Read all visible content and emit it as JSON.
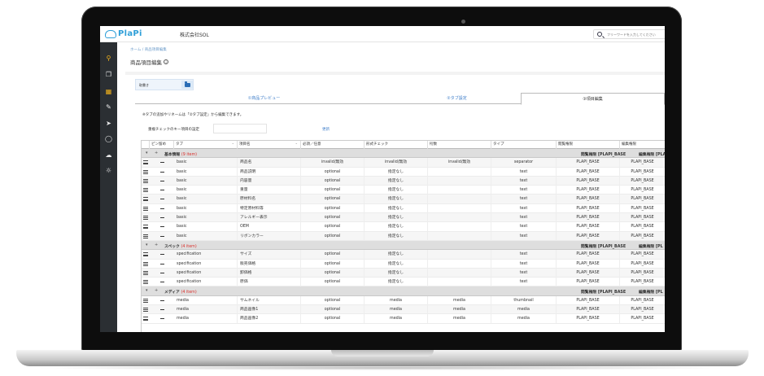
{
  "app": {
    "logo_text": "PlaPi",
    "company": "株式会社SOL",
    "search_placeholder": "フリーワードを入力してください"
  },
  "sidebar": {
    "items": [
      {
        "icon": "search-icon"
      },
      {
        "icon": "products-icon"
      },
      {
        "icon": "item-edit-icon"
      },
      {
        "icon": "pencil-icon"
      },
      {
        "icon": "rocket-icon"
      },
      {
        "icon": "shield-icon"
      },
      {
        "icon": "cloud-icon"
      },
      {
        "icon": "bulb-icon"
      }
    ],
    "more": "»"
  },
  "breadcrumb": "ホーム / 商品項目編集",
  "page_title": "商品項目編集",
  "info_glyph": "i",
  "file_input": {
    "label": "取書き"
  },
  "tabs": [
    {
      "label": "①商品プレビュー",
      "active": false
    },
    {
      "label": "②タブ設定",
      "active": false
    },
    {
      "label": "③項目編集",
      "active": true
    }
  ],
  "note": "※タブの追加やリネームは「②タブ設定」から編集できます。",
  "duplicate_check": {
    "label": "重複チェックのキー項目の設定",
    "link": "更新"
  },
  "table": {
    "headers": [
      "ピン留め",
      "タブ",
      "項目名",
      "必須／任意",
      "形式チェック",
      "桁数",
      "タイプ",
      "閲覧権限",
      "編集権限"
    ],
    "sort_glyph": "⌃",
    "groups": [
      {
        "name": "基本情報",
        "count": "(9 item)",
        "perm_view": "閲覧権限 [PLAPI_BASE",
        "perm_edit": "編集権限 [PLAPI_BA",
        "rows": [
          {
            "tab": "basic",
            "name": "商品名",
            "required": "invalid/無効",
            "format": "invalid/無効",
            "digits": "invalid/無効",
            "type": "separator",
            "view": "PLAPI_BASE",
            "edit": "PLAPI_BASE"
          },
          {
            "tab": "basic",
            "name": "商品説明",
            "required": "optional",
            "format": "指定なし",
            "digits": "",
            "type": "text",
            "view": "PLAPI_BASE",
            "edit": "PLAPI_BASE"
          },
          {
            "tab": "basic",
            "name": "内容量",
            "required": "optional",
            "format": "指定なし",
            "digits": "",
            "type": "text",
            "view": "PLAPI_BASE",
            "edit": "PLAPI_BASE"
          },
          {
            "tab": "basic",
            "name": "重量",
            "required": "optional",
            "format": "指定なし",
            "digits": "",
            "type": "text",
            "view": "PLAPI_BASE",
            "edit": "PLAPI_BASE"
          },
          {
            "tab": "basic",
            "name": "原材料名",
            "required": "optional",
            "format": "指定なし",
            "digits": "",
            "type": "text",
            "view": "PLAPI_BASE",
            "edit": "PLAPI_BASE"
          },
          {
            "tab": "basic",
            "name": "特定原材料等",
            "required": "optional",
            "format": "指定なし",
            "digits": "",
            "type": "text",
            "view": "PLAPI_BASE",
            "edit": "PLAPI_BASE"
          },
          {
            "tab": "basic",
            "name": "アレルギー表示",
            "required": "optional",
            "format": "指定なし",
            "digits": "",
            "type": "text",
            "view": "PLAPI_BASE",
            "edit": "PLAPI_BASE"
          },
          {
            "tab": "basic",
            "name": "OEM",
            "required": "optional",
            "format": "指定なし",
            "digits": "",
            "type": "text",
            "view": "PLAPI_BASE",
            "edit": "PLAPI_BASE"
          },
          {
            "tab": "basic",
            "name": "リボンカラー",
            "required": "optional",
            "format": "指定なし",
            "digits": "",
            "type": "text",
            "view": "PLAPI_BASE",
            "edit": "PLAPI_BASE"
          }
        ]
      },
      {
        "name": "スペック",
        "count": "(4 item)",
        "perm_view": "閲覧権限 [PLAPI_BASE",
        "perm_edit": "編集権限 [PL",
        "rows": [
          {
            "tab": "specification",
            "name": "サイズ",
            "required": "optional",
            "format": "指定なし",
            "digits": "",
            "type": "text",
            "view": "PLAPI_BASE",
            "edit": "PLAPI_BASE"
          },
          {
            "tab": "specification",
            "name": "販売価格",
            "required": "optional",
            "format": "指定なし",
            "digits": "",
            "type": "text",
            "view": "PLAPI_BASE",
            "edit": "PLAPI_BASE"
          },
          {
            "tab": "specification",
            "name": "卸価格",
            "required": "optional",
            "format": "指定なし",
            "digits": "",
            "type": "text",
            "view": "PLAPI_BASE",
            "edit": "PLAPI_BASE"
          },
          {
            "tab": "specification",
            "name": "原価",
            "required": "optional",
            "format": "指定なし",
            "digits": "",
            "type": "text",
            "view": "PLAPI_BASE",
            "edit": "PLAPI_BASE"
          }
        ]
      },
      {
        "name": "メディア",
        "count": "(4 item)",
        "perm_view": "閲覧権限 [PLAPI_BASE",
        "perm_edit": "編集権限 [PL",
        "rows": [
          {
            "tab": "media",
            "name": "サムネイル",
            "required": "optional",
            "format": "media",
            "digits": "media",
            "type": "thumbnail",
            "view": "PLAPI_BASE",
            "edit": "PLAPI_BASE"
          },
          {
            "tab": "media",
            "name": "商品画像1",
            "required": "optional",
            "format": "media",
            "digits": "media",
            "type": "media",
            "view": "PLAPI_BASE",
            "edit": "PLAPI_BASE"
          },
          {
            "tab": "media",
            "name": "商品画像2",
            "required": "optional",
            "format": "media",
            "digits": "media",
            "type": "media",
            "view": "PLAPI_BASE",
            "edit": "PLAPI_BASE"
          }
        ]
      }
    ]
  },
  "colors": {
    "accent": "#2f9fd8",
    "sidebar": "#2b2f33",
    "count_red": "#d9302c",
    "link": "#3a7bc8"
  }
}
